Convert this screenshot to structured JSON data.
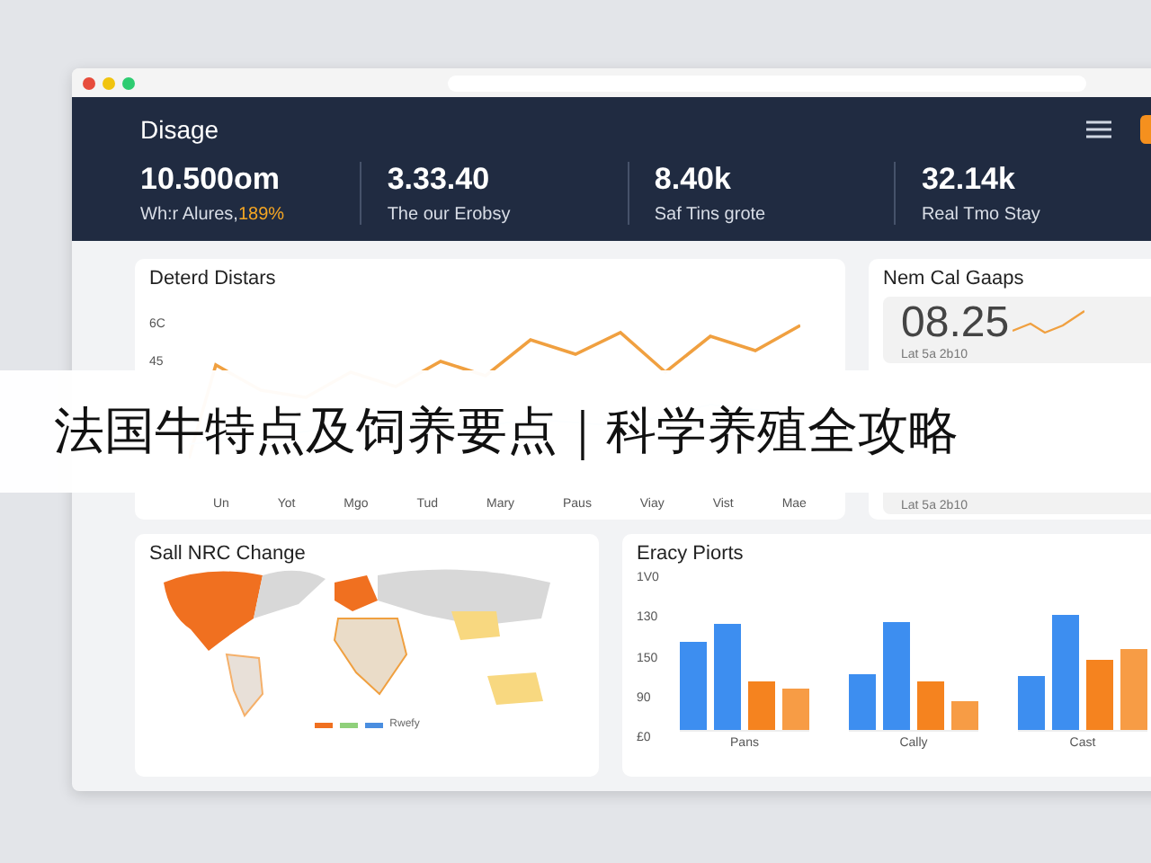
{
  "header": {
    "title": "Disage",
    "stats": [
      {
        "value": "10.500om",
        "label": "Wh:r Alures,",
        "change": "189%"
      },
      {
        "value": "3.33.40",
        "label": "The our Erobsy"
      },
      {
        "value": "8.40k",
        "label": "Saf Tins grote"
      },
      {
        "value": "32.14k",
        "label": "Real Tmo Stay"
      }
    ]
  },
  "line_card": {
    "title": "Deterd Distars",
    "yticks": [
      "6C",
      "45"
    ],
    "xlabels": [
      "Un",
      "Yot",
      "Mgo",
      "Tud",
      "Mary",
      "Paus",
      "Viay",
      "Vist",
      "Mae"
    ]
  },
  "gauges": {
    "title": "Nem Cal Gaaps",
    "items": [
      {
        "value": "08.25",
        "caption": "Lat 5a 2b10"
      },
      {
        "caption": "Lat 5a 2b10"
      }
    ]
  },
  "map_card": {
    "title": "Sall NRC Change",
    "legend": "Rwefy"
  },
  "bar_card": {
    "title": "Eracy Piorts",
    "yticks": [
      "1V0",
      "130",
      "150",
      "90",
      "£0"
    ],
    "xlabels": [
      "Pans",
      "Cally",
      "Cast"
    ]
  },
  "banner": {
    "text": "法国牛特点及饲养要点｜科学养殖全攻略"
  }
}
